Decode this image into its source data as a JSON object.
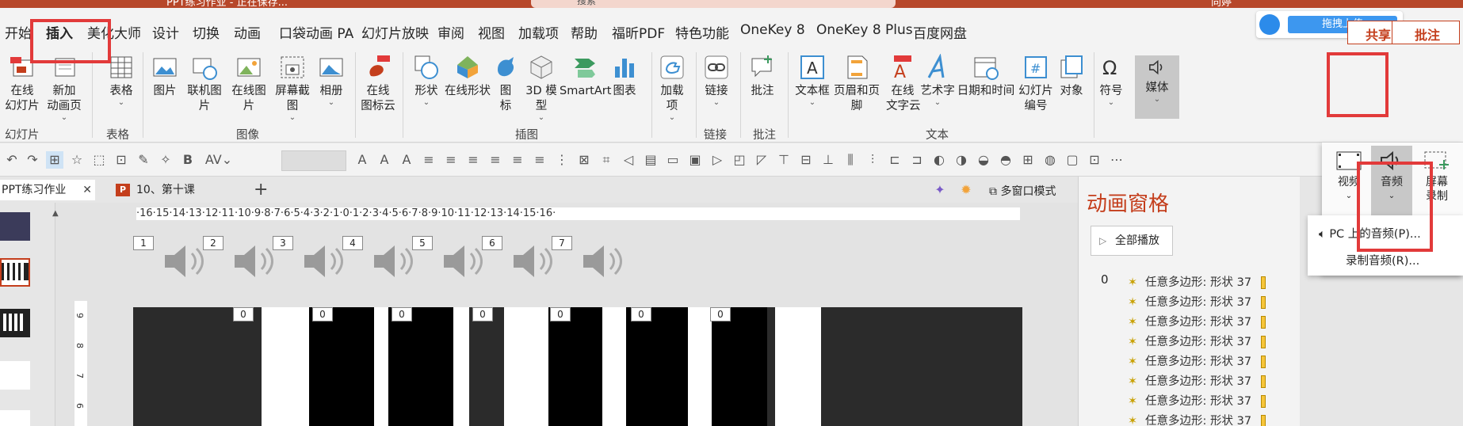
{
  "titlebar": {
    "title": "PPT练习作业 - 正在保存...",
    "search_placeholder": "搜索",
    "user": "向婷"
  },
  "tabs": [
    {
      "label": "开始"
    },
    {
      "label": "插入"
    },
    {
      "label": "美化大师"
    },
    {
      "label": "设计"
    },
    {
      "label": "切换"
    },
    {
      "label": "动画"
    },
    {
      "label": "口袋动画 PA"
    },
    {
      "label": "幻灯片放映"
    },
    {
      "label": "审阅"
    },
    {
      "label": "视图"
    },
    {
      "label": "加载项"
    },
    {
      "label": "帮助"
    },
    {
      "label": "福昕PDF"
    },
    {
      "label": "特色功能"
    },
    {
      "label": "OneKey 8"
    },
    {
      "label": "OneKey 8 Plus"
    },
    {
      "label": "百度网盘"
    }
  ],
  "upload": {
    "label": "拖拽上传"
  },
  "share_label": "共享",
  "comment_label": "批注",
  "ribbon": {
    "online_slides": "在线\n幻灯片",
    "new_anim_page": "新加\n动画页",
    "table": "表格",
    "picture": "图片",
    "online_picture_linked": "联机图片",
    "online_picture": "在线图片",
    "screenshot": "屏幕截图",
    "album": "相册",
    "online_icon_cloud": "在线\n图标云",
    "shapes": "形状",
    "online_shapes": "在线形状",
    "icons": "图\n标",
    "model_3d": "3D 模\n型",
    "smartart": "SmartArt",
    "chart": "图表",
    "addins": "加载\n项",
    "link": "链接",
    "comment": "批注",
    "textbox": "文本框",
    "header_footer": "页眉和页脚",
    "online_text_cloud": "在线\n文字云",
    "wordart": "艺术字",
    "date_time": "日期和时间",
    "slide_number": "幻灯片\n编号",
    "object": "对象",
    "symbol": "符号",
    "media": "媒体",
    "groups": {
      "slides": "幻灯片",
      "tables": "表格",
      "images": "图像",
      "illustrations": "插图",
      "links": "链接",
      "comments": "批注",
      "text": "文本"
    }
  },
  "doctabs": {
    "tab1": "PPT练习作业",
    "tab2": "10、第十课",
    "multiwindow": "多窗口模式"
  },
  "ruler": "·16·15·14·13·12·11·10·9·8·7·6·5·4·3·2·1·0·1·2·3·4·5·6·7·8·9·10·11·12·13·14·15·16·",
  "ruler_v": [
    "9",
    "8",
    "7",
    "6"
  ],
  "speakers": [
    "1",
    "2",
    "3",
    "4",
    "5",
    "6",
    "7"
  ],
  "key_labels": [
    "0",
    "0",
    "0",
    "0",
    "0",
    "0",
    "0"
  ],
  "anim_pane": {
    "title": "动画窗格",
    "play_all": "全部播放",
    "index": "0",
    "items": [
      "任意多边形: 形状 37",
      "任意多边形: 形状 37",
      "任意多边形: 形状 37",
      "任意多边形: 形状 37",
      "任意多边形: 形状 37",
      "任意多边形: 形状 37",
      "任意多边形: 形状 37",
      "任意多边形: 形状 37"
    ]
  },
  "media_panel": {
    "video": "视频",
    "audio": "音频",
    "screen_record": "屏幕\n录制"
  },
  "audio_menu": {
    "pc_audio": "PC 上的音频(P)...",
    "record_audio": "录制音频(R)..."
  },
  "colors": {
    "accent": "#c43e1c",
    "highlight": "#e23a3a",
    "title_bar": "#b7472a"
  }
}
